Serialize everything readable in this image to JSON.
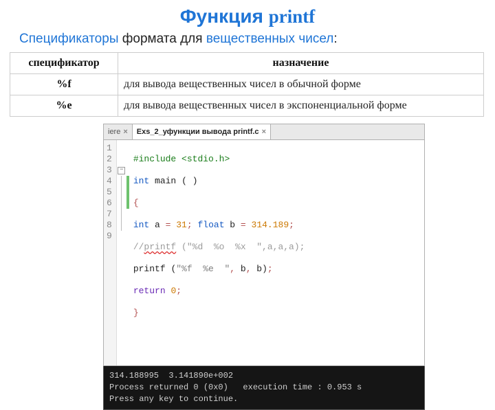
{
  "title": {
    "part1": "Функция",
    "part2": "printf"
  },
  "subtitle": {
    "part1": "Спецификаторы ",
    "part2": "формата для ",
    "part3": "вещественных чисел",
    "part4": ":"
  },
  "table": {
    "headers": [
      "спецификатор",
      "назначение"
    ],
    "rows": [
      {
        "spec": "%f",
        "desc": "для вывода вещественных чисел в обычной форме"
      },
      {
        "spec": "%e",
        "desc": "для вывода вещественных чисел в экспоненциальной форме"
      }
    ]
  },
  "tabs": {
    "partial": {
      "label": "iere",
      "close": "×"
    },
    "active": {
      "label": "Exs_2_уфункции вывода printf.c",
      "close": "×"
    }
  },
  "code": {
    "lineNumbers": [
      "1",
      "2",
      "3",
      "4",
      "5",
      "6",
      "7",
      "8",
      "9"
    ],
    "lines": {
      "l1": {
        "a": "#include",
        "b": " ",
        "c": "<stdio.h>"
      },
      "l2": {
        "a": "int",
        "b": " ",
        "c": "main",
        "d": " ",
        "e": "(",
        "f": " ",
        "g": ")"
      },
      "l3": {
        "a": "{"
      },
      "l4": {
        "a": "int",
        "b": " a ",
        "c": "=",
        "d": " ",
        "e": "31",
        "f": ";",
        "g": " ",
        "h": "float",
        "i": " b ",
        "j": "=",
        "k": " ",
        "l": "314.189",
        "m": ";"
      },
      "l5": {
        "a": "//",
        "b": "printf",
        "c": " (\"%d  %o  %x  \",a,a,a);"
      },
      "l6": {
        "a": "printf",
        "b": " ",
        "c": "(",
        "d": "\"%f  %e  \"",
        "e": ",",
        "f": " b",
        "g": ",",
        "h": " b",
        "i": ")",
        "j": ";"
      },
      "l7": {
        "a": "return",
        "b": " ",
        "c": "0",
        "d": ";"
      },
      "l8": {
        "a": "}"
      }
    },
    "fold": {
      "minus": "−"
    }
  },
  "console": {
    "line1": "314.188995  3.141890e+002",
    "line2": "Process returned 0 (0x0)   execution time : 0.953 s",
    "line3": "Press any key to continue."
  }
}
